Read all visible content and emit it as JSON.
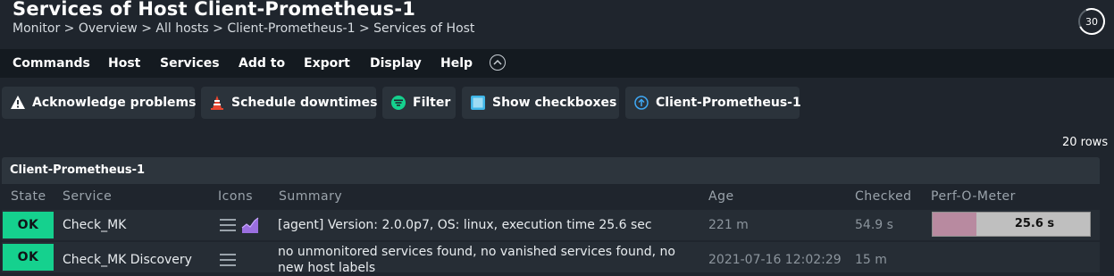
{
  "header": {
    "title": "Services of Host Client-Prometheus-1",
    "breadcrumb": "Monitor > Overview > All hosts > Client-Prometheus-1 > Services of Host",
    "refresh_seconds": "30"
  },
  "menu": {
    "items": [
      "Commands",
      "Host",
      "Services",
      "Add to",
      "Export",
      "Display",
      "Help"
    ]
  },
  "toolbar": {
    "acknowledge": "Acknowledge problems",
    "downtimes": "Schedule downtimes",
    "filter": "Filter",
    "checkboxes": "Show checkboxes",
    "host": "Client-Prometheus-1"
  },
  "table": {
    "row_count": "20 rows",
    "group": "Client-Prometheus-1",
    "columns": [
      "State",
      "Service",
      "Icons",
      "Summary",
      "Age",
      "Checked",
      "Perf-O-Meter"
    ],
    "rows": [
      {
        "state": "OK",
        "service": "Check_MK",
        "summary": "[agent] Version: 2.0.0p7, OS: linux, execution time 25.6 sec",
        "age": "221 m",
        "checked": "54.9 s",
        "perf_text": "25.6 s",
        "perf_fraction": 0.28
      },
      {
        "state": "OK",
        "service": "Check_MK Discovery",
        "summary": "no unmonitored services found, no vanished services found, no new host labels",
        "age": "2021-07-16 12:02:29",
        "checked": "15 m"
      }
    ]
  },
  "colors": {
    "state_ok": "#15d18e",
    "background": "#1f252d",
    "menubar": "#141a20"
  }
}
